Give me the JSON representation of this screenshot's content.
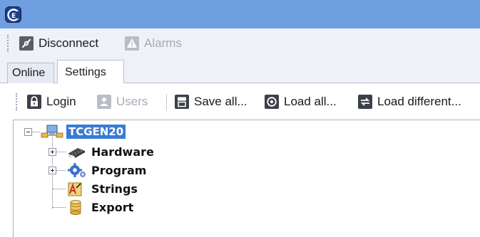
{
  "app": {
    "logo_icon": "ce-app-logo-icon",
    "title_bar_color": "#6f9fe0"
  },
  "toolbar": {
    "disconnect_label": "Disconnect",
    "disconnect_icon": "plug-icon",
    "alarms_label": "Alarms",
    "alarms_icon": "warning-icon"
  },
  "tabs": [
    {
      "label": "Online",
      "active": false
    },
    {
      "label": "Settings",
      "active": true
    }
  ],
  "settings_toolbar": {
    "login_label": "Login",
    "login_icon": "lock-icon",
    "users_label": "Users",
    "users_icon": "users-icon",
    "save_all_label": "Save all...",
    "save_all_icon": "save-icon",
    "load_all_label": "Load all...",
    "load_all_icon": "load-icon",
    "load_different_label": "Load different..."
  },
  "tree": {
    "root": {
      "label": "TCGEN20",
      "icon": "computer-network-icon",
      "selected": true
    },
    "children": [
      {
        "label": "Hardware",
        "icon": "chip-icon",
        "expandable": true
      },
      {
        "label": "Program",
        "icon": "gear-icon",
        "expandable": true
      },
      {
        "label": "Strings",
        "icon": "strings-icon",
        "expandable": false
      },
      {
        "label": "Export",
        "icon": "database-icon",
        "expandable": false
      }
    ]
  }
}
